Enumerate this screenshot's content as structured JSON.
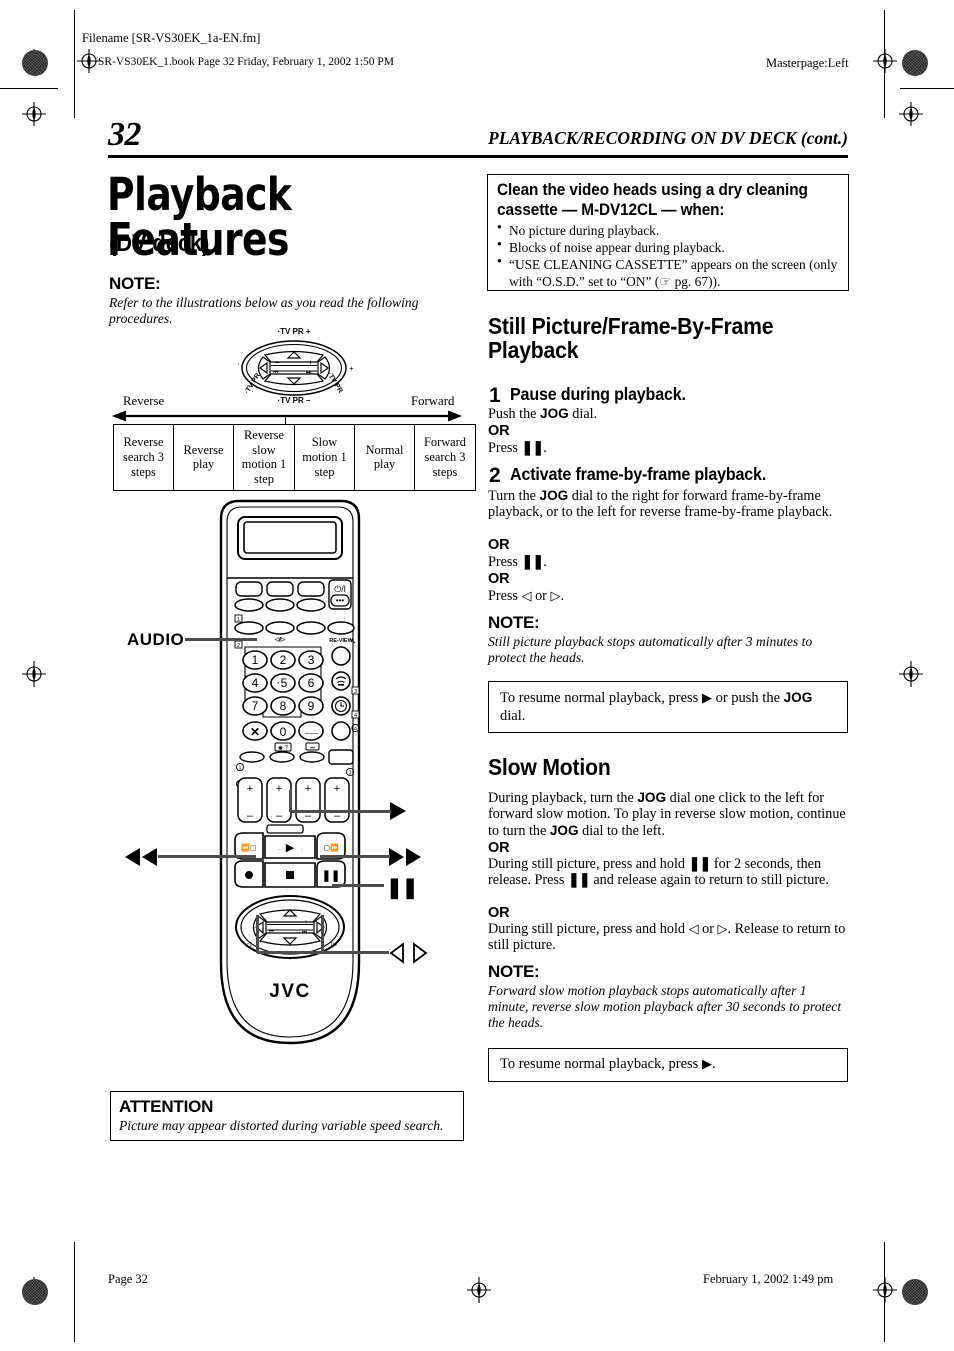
{
  "print_slug": {
    "filename_line": "Filename [SR-VS30EK_1a-EN.fm]",
    "book_line": "SR-VS30EK_1.book  Page 32  Friday, February 1, 2002  1:50 PM",
    "masterpage": "Masterpage:Left"
  },
  "running_head": {
    "page_number": "32",
    "title": "PLAYBACK/RECORDING ON DV DECK (cont.)"
  },
  "left_column": {
    "title": "Playback Features",
    "subtitle": "(DV deck)",
    "note_heading": "NOTE:",
    "note_text": "Refer to the illustrations below as you read the following procedures.",
    "jog_dial_labels": {
      "top": "TV PR +",
      "bottom": "TV PR –",
      "left_minus": "–",
      "right_plus": "+",
      "left_skip": "⏮",
      "right_skip": "⏭"
    },
    "direction_labels": {
      "reverse": "Reverse",
      "forward": "Forward"
    },
    "speed_table": [
      "Reverse search 3 steps",
      "Reverse play",
      "Reverse slow motion 1 step",
      "Slow motion 1 step",
      "Normal play",
      "Forward search 3 steps"
    ],
    "speed_table_rows": [
      [
        "Reverse",
        "Reverse",
        "Reverse",
        "Slow",
        "Normal",
        "Forward"
      ],
      [
        "search",
        "play",
        "slow",
        "motion",
        "play",
        "search"
      ],
      [
        "3 steps",
        "",
        "motion",
        "1 step",
        "",
        "3 steps"
      ],
      [
        "",
        "",
        "1 step",
        "",
        "",
        ""
      ]
    ],
    "remote": {
      "brand": "JVC",
      "power_label": "⏻/I",
      "audio_callout": "AUDIO",
      "keypad": [
        "1",
        "2",
        "3",
        "4",
        "5",
        "6",
        "7",
        "8",
        "9",
        "✕",
        "0",
        "╱╱╱"
      ],
      "review_label": "RE-VIEW",
      "callouts": {
        "rew": "◀◀",
        "ff": "▶▶",
        "play": "▶",
        "pause": "▐▐",
        "arrows": "◁ ▷"
      },
      "marker_numbers": [
        "1",
        "2",
        "3",
        "4"
      ],
      "marker_circles": [
        "1",
        "2",
        "3",
        "4"
      ]
    },
    "attention_box": {
      "heading": "ATTENTION",
      "text": "Picture may appear distorted during variable speed search."
    }
  },
  "right_column": {
    "cleaning_box": {
      "heading_line1": "Clean the video heads using a dry cleaning",
      "heading_line2": "cassette — M-DV12CL — when:",
      "bullets": [
        "No picture during playback.",
        "Blocks of noise appear during playback.",
        "“USE CLEANING CASSETTE” appears on the screen (only with “O.S.D.” set to “ON” (☞ pg. 67))."
      ]
    },
    "section1": {
      "title": "Still Picture/Frame-By-Frame Playback",
      "steps": [
        {
          "num": "1",
          "head": "Pause during playback.",
          "lines": [
            {
              "type": "body",
              "text": "Push the JOG dial.",
              "bold_word": "JOG"
            },
            {
              "type": "or",
              "text": "OR"
            },
            {
              "type": "body",
              "text": "Press ▐▐."
            }
          ]
        },
        {
          "num": "2",
          "head": "Activate frame-by-frame playback.",
          "lines": [
            {
              "type": "body",
              "text": "Turn the JOG dial to the right for forward frame-by-frame playback, or to the left for reverse frame-by-frame playback.",
              "bold_word": "JOG"
            },
            {
              "type": "or",
              "text": "OR"
            },
            {
              "type": "body",
              "text": "Press ▐▐."
            },
            {
              "type": "or",
              "text": "OR"
            },
            {
              "type": "body",
              "text": "Press ◁ or ▷."
            }
          ]
        }
      ],
      "note_heading": "NOTE:",
      "note_text": "Still picture playback stops automatically after 3 minutes to protect the heads.",
      "resume_box": "To resume normal playback, press ▶ or push the JOG dial."
    },
    "section2": {
      "title": "Slow Motion",
      "paragraphs": [
        {
          "type": "body",
          "text": "During playback, turn the JOG dial one click to the left for forward slow motion. To play in reverse slow motion, continue to turn the JOG dial to the left."
        },
        {
          "type": "or",
          "text": "OR"
        },
        {
          "type": "body",
          "text": "During still picture, press and hold ▐▐ for 2 seconds, then release. Press ▐▐ and release again to return to still picture."
        },
        {
          "type": "or",
          "text": "OR"
        },
        {
          "type": "body",
          "text": "During still picture, press and hold ◁ or ▷. Release to return to still picture."
        }
      ],
      "note_heading": "NOTE:",
      "note_text": "Forward slow motion playback stops automatically after 1 minute, reverse slow motion playback after 30 seconds to protect the heads.",
      "resume_box": "To resume normal playback, press ▶."
    }
  },
  "footer": {
    "page_label": "Page 32",
    "timestamp": "February 1, 2002 1:49 pm"
  }
}
